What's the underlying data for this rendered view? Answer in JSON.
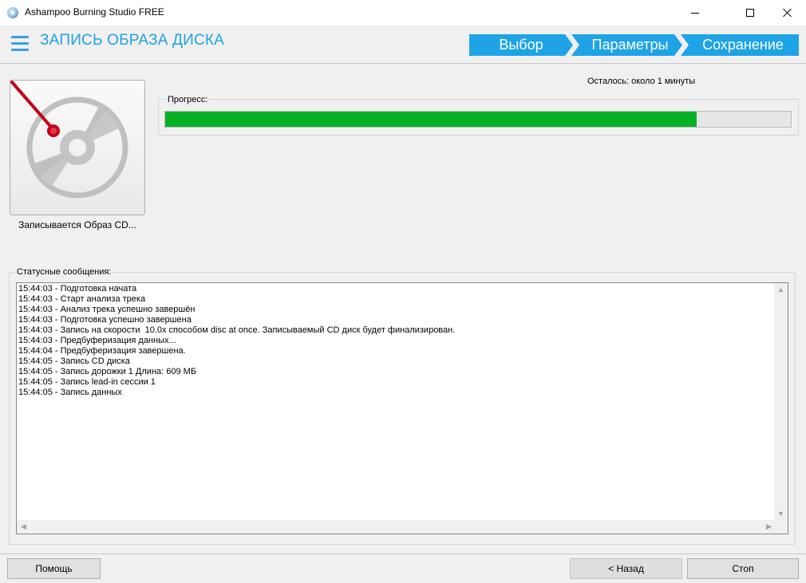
{
  "window": {
    "title": "Ashampoo Burning Studio FREE"
  },
  "header": {
    "page_title": "ЗАПИСЬ ОБРАЗА ДИСКА",
    "steps": [
      {
        "label": "Выбор"
      },
      {
        "label": "Параметры"
      },
      {
        "label": "Сохранение"
      }
    ]
  },
  "disc": {
    "caption": "Записывается Образ CD..."
  },
  "progress": {
    "remaining": "Осталось: около 1 минуты",
    "label": "Прогресс:",
    "value_percent": 85
  },
  "status": {
    "label": "Статусные сообщения:",
    "lines": [
      "15:44:03 - Подготовка начата",
      "15:44:03 - Старт анализа трека",
      "15:44:03 - Анализ трека успешно завершён",
      "15:44:03 - Подготовка успешно завершена",
      "15:44:03 - Запись на скорости  10.0x способом disc at once. Записываемый CD диск будет финализирован.",
      "15:44:03 - Предбуферизация данных...",
      "15:44:04 - Предбуферизация завершена.",
      "15:44:05 - Запись CD диска",
      "15:44:05 - Запись дорожки 1 Длина: 609 МБ",
      "15:44:05 - Запись lead-in сессии 1",
      "15:44:05 - Запись данных"
    ]
  },
  "buttons": {
    "help": "Помощь",
    "back": "< Назад",
    "stop": "Стоп"
  },
  "colors": {
    "accent": "#1ea3e6",
    "progress": "#06b025"
  }
}
